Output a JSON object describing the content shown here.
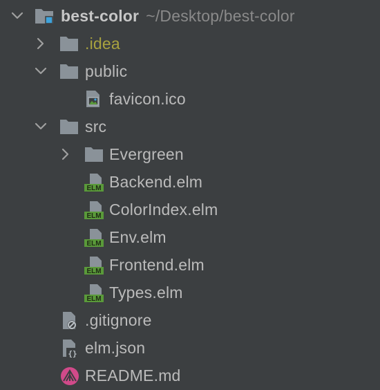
{
  "tree": {
    "root": {
      "name": "best-color",
      "path": "~/Desktop/best-color",
      "expanded": true,
      "icon": "module-folder-icon"
    },
    "items": [
      {
        "name": ".idea",
        "kind": "folder",
        "expanded": false,
        "icon": "folder-icon",
        "color": "#a8a23f"
      },
      {
        "name": "public",
        "kind": "folder",
        "expanded": true,
        "icon": "folder-icon"
      },
      {
        "name": "favicon.ico",
        "kind": "file",
        "icon": "image-file-icon"
      },
      {
        "name": "src",
        "kind": "folder",
        "expanded": true,
        "icon": "folder-icon"
      },
      {
        "name": "Evergreen",
        "kind": "folder",
        "expanded": false,
        "icon": "folder-icon"
      },
      {
        "name": "Backend.elm",
        "kind": "file",
        "icon": "elm-file-icon"
      },
      {
        "name": "ColorIndex.elm",
        "kind": "file",
        "icon": "elm-file-icon"
      },
      {
        "name": "Env.elm",
        "kind": "file",
        "icon": "elm-file-icon"
      },
      {
        "name": "Frontend.elm",
        "kind": "file",
        "icon": "elm-file-icon"
      },
      {
        "name": "Types.elm",
        "kind": "file",
        "icon": "elm-file-icon"
      },
      {
        "name": ".gitignore",
        "kind": "file",
        "icon": "ignore-file-icon"
      },
      {
        "name": "elm.json",
        "kind": "file",
        "icon": "json-file-icon"
      },
      {
        "name": "README.md",
        "kind": "file",
        "icon": "markdown-file-icon"
      }
    ],
    "elm_badge": "ELM",
    "colors": {
      "background": "#3c3f41",
      "text": "#bbbbbb",
      "folder": "#8a9299",
      "elm_badge": "#5a9a3a",
      "markdown": "#d14a8a",
      "module_marker": "#3ea3dc"
    }
  }
}
